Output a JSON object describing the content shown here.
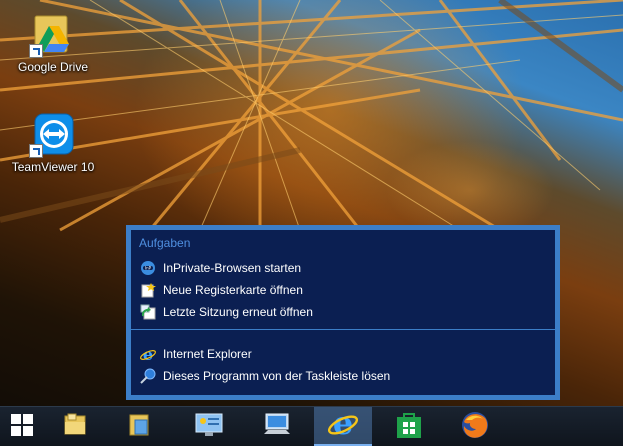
{
  "desktop": {
    "icons": [
      {
        "label": "Google Drive",
        "icon": "google-drive-icon"
      },
      {
        "label": "TeamViewer 10",
        "icon": "teamviewer-icon"
      }
    ]
  },
  "jumplist": {
    "heading": "Aufgaben",
    "tasks": [
      {
        "label": "InPrivate-Browsen starten",
        "icon": "inprivate-icon"
      },
      {
        "label": "Neue Registerkarte öffnen",
        "icon": "new-tab-icon"
      },
      {
        "label": "Letzte Sitzung erneut öffnen",
        "icon": "reopen-session-icon"
      }
    ],
    "program": {
      "label": "Internet Explorer",
      "icon": "internet-explorer-icon"
    },
    "unpin": {
      "label": "Dieses Programm von der Taskleiste lösen",
      "icon": "unpin-icon"
    }
  },
  "taskbar": {
    "buttons": [
      {
        "icon": "windows-start-icon"
      },
      {
        "icon": "file-explorer-icon"
      },
      {
        "icon": "folder-icon"
      },
      {
        "icon": "control-panel-icon"
      },
      {
        "icon": "computer-icon"
      },
      {
        "icon": "internet-explorer-icon",
        "active": true
      },
      {
        "icon": "windows-store-icon"
      },
      {
        "icon": "firefox-icon"
      }
    ]
  },
  "colors": {
    "jumplist_frame": "#3c7ec8",
    "jumplist_background": "#0b1f52",
    "heading": "#4f8fe0",
    "taskbar": "#131b25",
    "active_accent": "#79b0ef"
  }
}
